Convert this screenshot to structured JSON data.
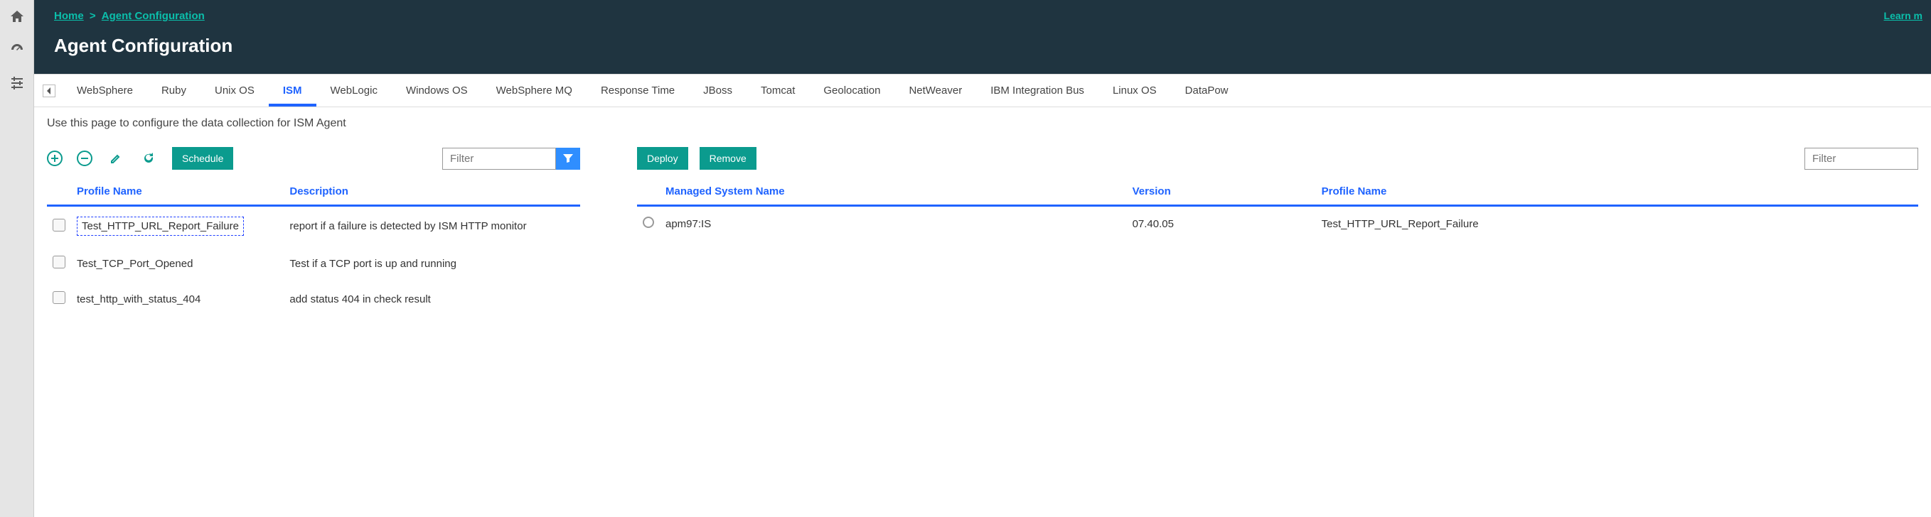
{
  "breadcrumb": {
    "home": "Home",
    "sep": ">",
    "current": "Agent Configuration"
  },
  "page_title": "Agent Configuration",
  "learn_more": "Learn m",
  "tabs": [
    {
      "label": "WebSphere",
      "active": false
    },
    {
      "label": "Ruby",
      "active": false
    },
    {
      "label": "Unix OS",
      "active": false
    },
    {
      "label": "ISM",
      "active": true
    },
    {
      "label": "WebLogic",
      "active": false
    },
    {
      "label": "Windows OS",
      "active": false
    },
    {
      "label": "WebSphere MQ",
      "active": false
    },
    {
      "label": "Response Time",
      "active": false
    },
    {
      "label": "JBoss",
      "active": false
    },
    {
      "label": "Tomcat",
      "active": false
    },
    {
      "label": "Geolocation",
      "active": false
    },
    {
      "label": "NetWeaver",
      "active": false
    },
    {
      "label": "IBM Integration Bus",
      "active": false
    },
    {
      "label": "Linux OS",
      "active": false
    },
    {
      "label": "DataPow",
      "active": false
    }
  ],
  "instruction": "Use this page to configure the data collection for ISM Agent",
  "left": {
    "schedule_label": "Schedule",
    "filter_placeholder": "Filter",
    "headers": {
      "profile": "Profile Name",
      "desc": "Description"
    },
    "rows": [
      {
        "profile": "Test_HTTP_URL_Report_Failure",
        "desc": "report if a failure is detected by ISM HTTP monitor",
        "selected_indicator": true
      },
      {
        "profile": "Test_TCP_Port_Opened",
        "desc": "Test if a TCP port is up and running",
        "selected_indicator": false
      },
      {
        "profile": "test_http_with_status_404",
        "desc": "add status 404 in check result",
        "selected_indicator": false
      }
    ]
  },
  "right": {
    "deploy_label": "Deploy",
    "remove_label": "Remove",
    "filter_placeholder": "Filter",
    "headers": {
      "system": "Managed System Name",
      "version": "Version",
      "profile": "Profile Name"
    },
    "rows": [
      {
        "system": "apm97:IS",
        "version": "07.40.05",
        "profile": "Test_HTTP_URL_Report_Failure"
      }
    ]
  }
}
